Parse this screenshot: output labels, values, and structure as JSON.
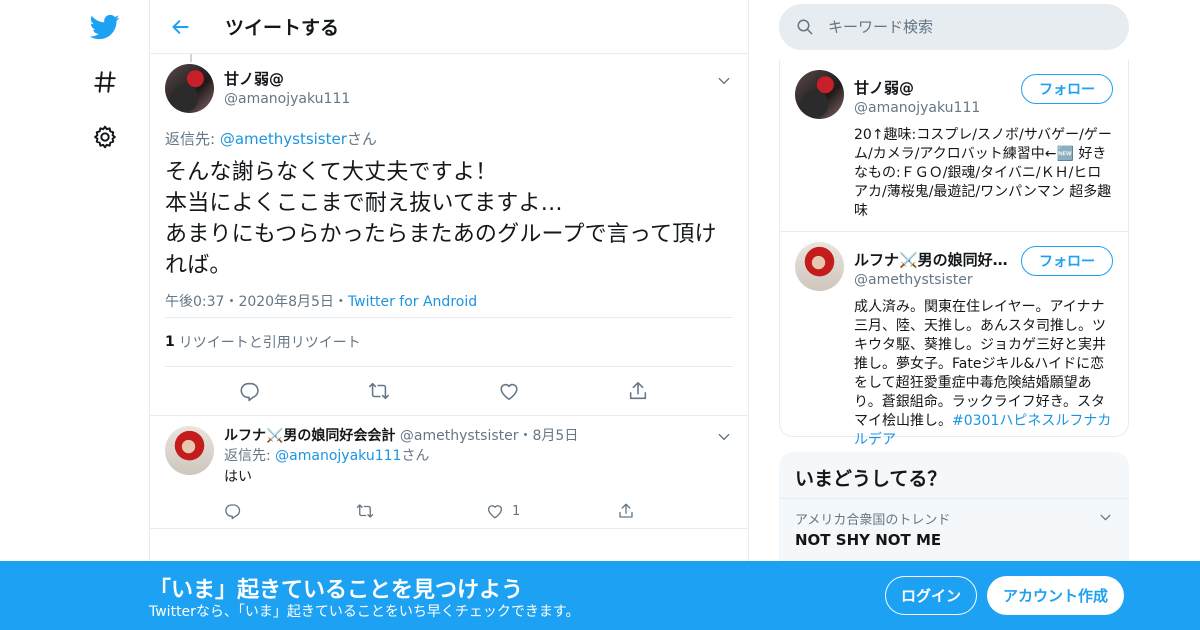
{
  "colors": {
    "accent": "#1da1f2",
    "link": "#1b95e0",
    "muted": "#657786",
    "text": "#14171a",
    "border": "#e6ecf0"
  },
  "nav": {
    "icons": [
      "twitter-bird-icon",
      "hashtag-icon",
      "gear-icon"
    ]
  },
  "header": {
    "title": "ツイートする",
    "back_icon": "arrow-left-icon"
  },
  "focus_tweet": {
    "display_name": "甘ノ弱@",
    "handle": "@amanojyaku111",
    "reply_prefix": "返信先: ",
    "reply_to": "@amethystsister",
    "reply_suffix": "さん",
    "text": "そんな謝らなくて大丈夫ですよ！\n本当によくここまで耐え抜いてますよ…\nあまりにもつらかったらまたあのグループで言って頂ければ。",
    "time": "午後0:37",
    "sep1": "・",
    "date": "2020年8月5日",
    "sep2": "・",
    "source": "Twitter for Android",
    "retweet_count": "1",
    "retweet_label": "リツイートと引用リツイート",
    "action_icons": [
      "reply-icon",
      "retweet-icon",
      "like-icon",
      "share-icon"
    ]
  },
  "reply_tweet": {
    "display_name": "ルフナ⚔️男の娘同好会会計",
    "handle": "@amethystsister",
    "sep": "・",
    "date": "8月5日",
    "reply_prefix": "返信先: ",
    "reply_to": "@amanojyaku111",
    "reply_suffix": "さん",
    "text": "はい",
    "like_count": "1"
  },
  "search": {
    "placeholder": "キーワード検索"
  },
  "profiles": [
    {
      "display_name": "甘ノ弱@",
      "handle": "@amanojyaku111",
      "follow_label": "フォロー",
      "bio": "20↑趣味:コスプレ/スノボ/サバゲー/ゲーム/カメラ/アクロバット練習中←🆕 好きなもの:ＦＧＯ/銀魂/タイバニ/ＫＨ/ヒロアカ/薄桜鬼/最遊記/ワンパンマン 超多趣味"
    },
    {
      "display_name": "ルフナ⚔️男の娘同好…",
      "handle": "@amethystsister",
      "follow_label": "フォロー",
      "bio": "成人済み。関東在住レイヤー。アイナナ三月、陸、天推し。あんスタ司推し。ツキウタ駆、葵推し。ジョカゲ三好と実井推し。夢女子。Fateジキル&ハイドに恋をして超狂愛重症中毒危険結婚願望あり。蒼銀組命。ラックライフ好き。スタマイ桧山推し。",
      "bio_hashtag": "#0301ハピネスルフナカルデア"
    }
  ],
  "trends": {
    "title": "いまどうしてる？",
    "items": [
      {
        "category": "アメリカ合衆国のトレンド",
        "name": "NOT SHY NOT ME"
      }
    ]
  },
  "banner": {
    "title": "「いま」起きていることを見つけよう",
    "subtitle": "Twitterなら、「いま」起きていることをいち早くチェックできます。",
    "login_label": "ログイン",
    "signup_label": "アカウント作成"
  }
}
